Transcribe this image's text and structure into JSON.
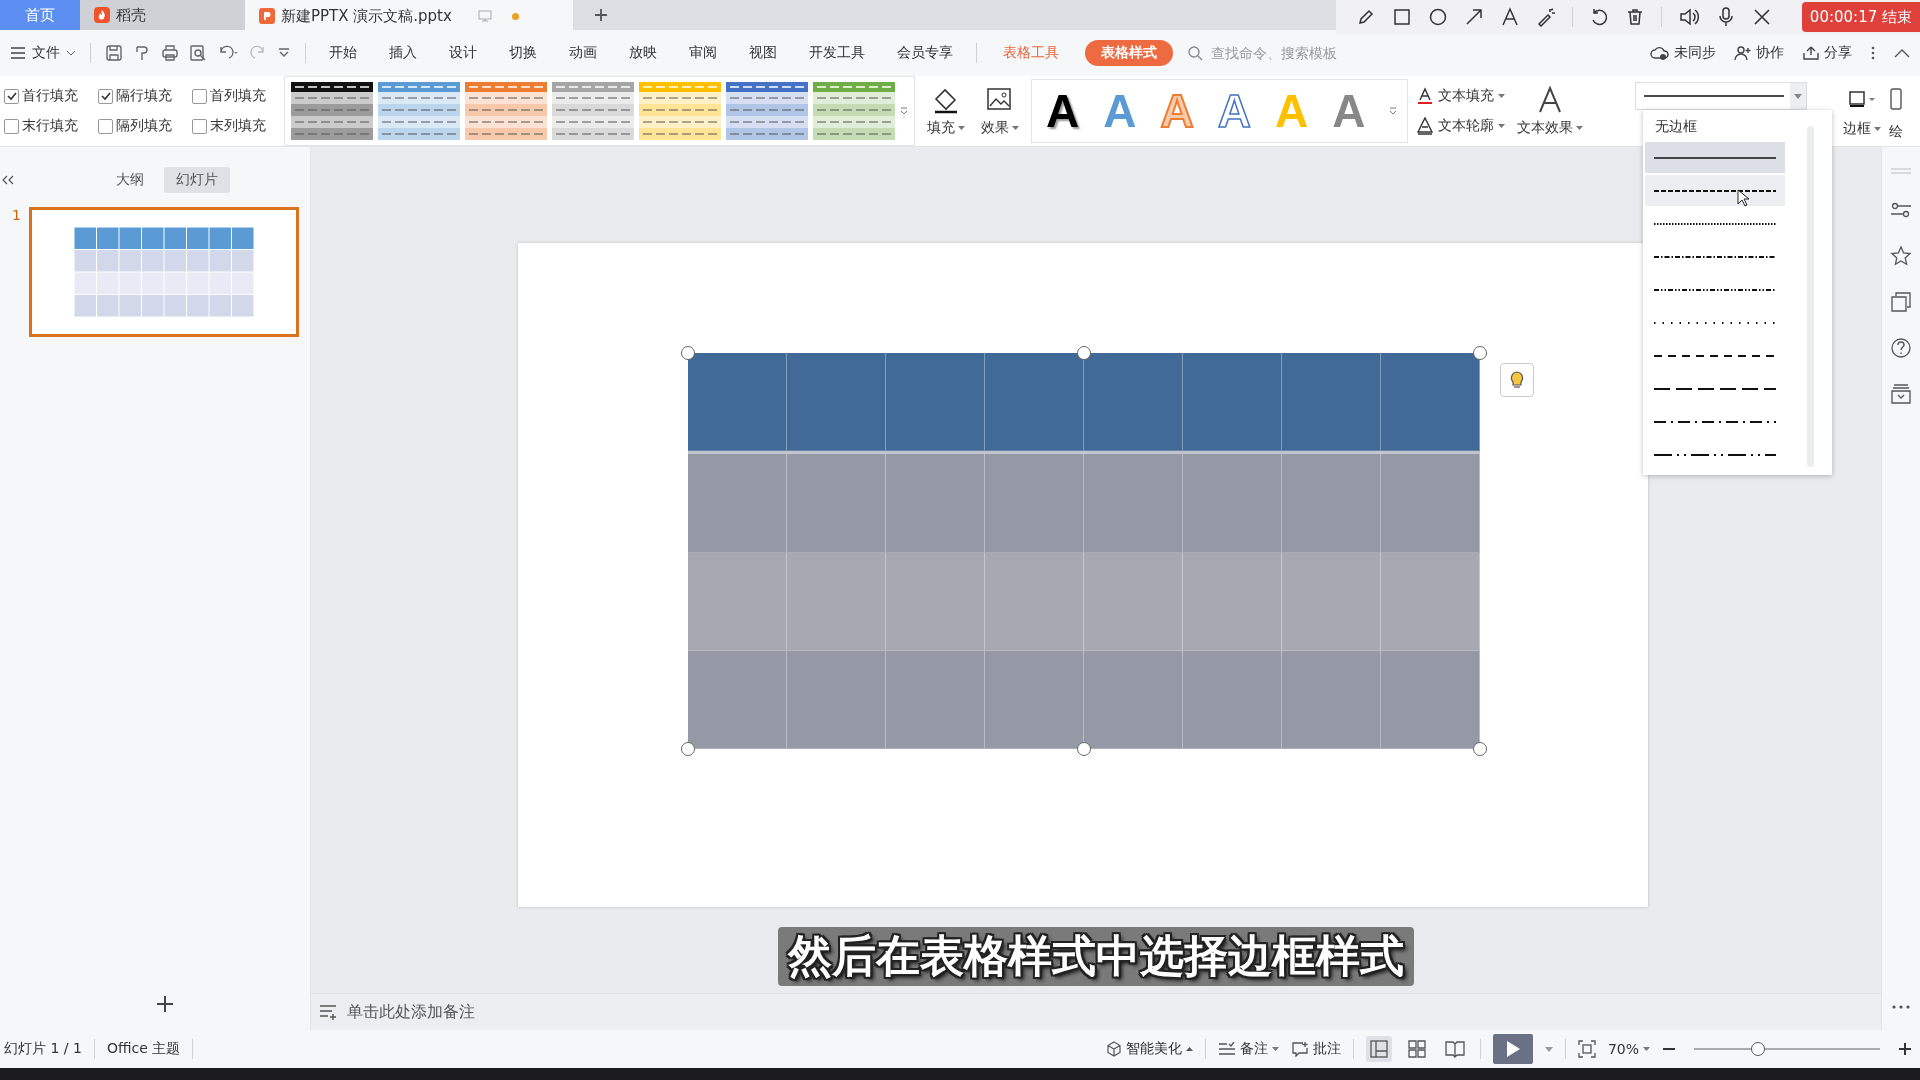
{
  "tabs": [
    {
      "label": "首页",
      "kind": "home",
      "selected": false
    },
    {
      "label": "稻壳",
      "kind": "docer",
      "selected": false
    },
    {
      "label": "新建PPTX 演示文稿.pptx",
      "kind": "doc",
      "selected": true
    }
  ],
  "recorder": {
    "timer": "00:00:17 结束"
  },
  "menu": {
    "file": "文件",
    "items": [
      "开始",
      "插入",
      "设计",
      "切换",
      "动画",
      "放映",
      "审阅",
      "视图",
      "开发工具",
      "会员专享"
    ],
    "context_label": "表格工具",
    "context_tab": "表格样式",
    "search": {
      "placeholder": "查找命令、搜索模板"
    },
    "actions": [
      "未同步",
      "协作",
      "分享"
    ]
  },
  "ribbon": {
    "checkboxes": [
      {
        "label": "首行填充",
        "checked": true
      },
      {
        "label": "隔行填充",
        "checked": true
      },
      {
        "label": "首列填充",
        "checked": false
      },
      {
        "label": "末行填充",
        "checked": false
      },
      {
        "label": "隔列填充",
        "checked": false
      },
      {
        "label": "末列填充",
        "checked": false
      }
    ],
    "table_styles": [
      {
        "color": "#111111"
      },
      {
        "color": "#5b9bd5"
      },
      {
        "color": "#ed7d31"
      },
      {
        "color": "#a5a5a5"
      },
      {
        "color": "#ffc000"
      },
      {
        "color": "#4472c4"
      },
      {
        "color": "#70ad47"
      }
    ],
    "fill": "填充",
    "effect": "效果",
    "text_styles": [
      {
        "glyph": "A",
        "kind": "black"
      },
      {
        "glyph": "A",
        "kind": "blue"
      },
      {
        "glyph": "A",
        "kind": "orange-outline"
      },
      {
        "glyph": "A",
        "kind": "blue-outline"
      },
      {
        "glyph": "A",
        "kind": "yellow"
      },
      {
        "glyph": "A",
        "kind": "gray"
      }
    ],
    "text_fill": "文本填充",
    "text_outline": "文本轮廓",
    "text_effect": "文本效果",
    "border": "边框",
    "draw": "绘"
  },
  "border_menu": {
    "none_label": "无边框",
    "styles": [
      {
        "kind": "solid",
        "selected": true,
        "hovered": false
      },
      {
        "kind": "dash",
        "selected": false,
        "hovered": true
      },
      {
        "kind": "dot",
        "selected": false,
        "hovered": false
      },
      {
        "kind": "dash-dot",
        "selected": false,
        "hovered": false
      },
      {
        "kind": "dash-dot-dot",
        "selected": false,
        "hovered": false
      },
      {
        "kind": "sparse-dot",
        "selected": false,
        "hovered": false
      },
      {
        "kind": "medium-dash",
        "selected": false,
        "hovered": false
      },
      {
        "kind": "long-dash",
        "selected": false,
        "hovered": false
      },
      {
        "kind": "long-dash-dot",
        "selected": false,
        "hovered": false
      },
      {
        "kind": "long-dash-dot-dot",
        "selected": false,
        "hovered": false
      }
    ]
  },
  "panel": {
    "views": [
      {
        "label": "大纲",
        "selected": false
      },
      {
        "label": "幻灯片",
        "selected": true
      }
    ],
    "slides": [
      {
        "number": "1",
        "selected": true
      }
    ]
  },
  "table": {
    "rows": [
      {
        "kind": "header"
      },
      {
        "kind": "body"
      },
      {
        "kind": "banded"
      },
      {
        "kind": "body"
      }
    ]
  },
  "notes": {
    "placeholder": "单击此处添加备注"
  },
  "subtitle": "然后在表格样式中选择边框样式",
  "status": {
    "slide": "幻灯片 1 / 1",
    "theme": "Office 主题",
    "beautify": "智能美化",
    "notes": "备注",
    "comment": "批注",
    "zoom": "70%",
    "zoom_slider": {
      "level": 0.33
    }
  }
}
